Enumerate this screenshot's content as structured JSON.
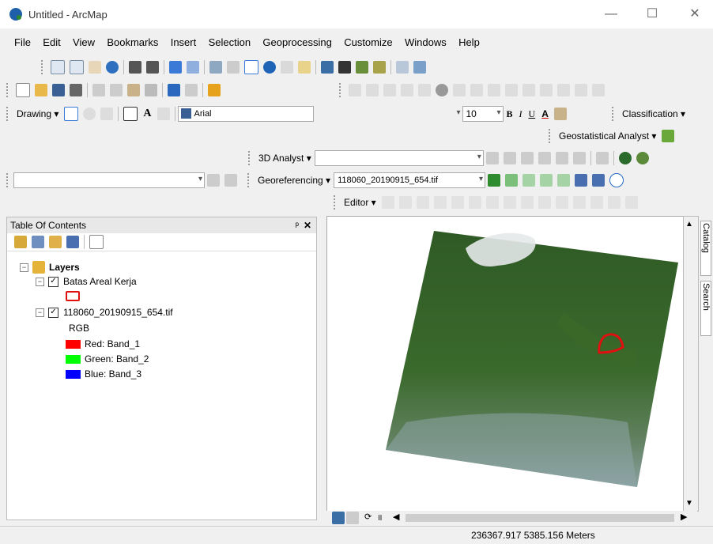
{
  "window": {
    "title": "Untitled - ArcMap",
    "minimize": "—",
    "maximize": "☐",
    "close": "✕"
  },
  "menu": [
    "File",
    "Edit",
    "View",
    "Bookmarks",
    "Insert",
    "Selection",
    "Geoprocessing",
    "Customize",
    "Windows",
    "Help"
  ],
  "toolbars": {
    "drawing": {
      "label": "Drawing ▾",
      "font": "Arial",
      "size": "10",
      "bold": "B",
      "italic": "I",
      "underline": "U",
      "textA": "A"
    },
    "classification": "Classification ▾",
    "geostatistical": "Geostatistical Analyst ▾",
    "analyst3d": "3D Analyst ▾",
    "georeferencing": {
      "label": "Georeferencing ▾",
      "layer": "118060_20190915_654.tif"
    },
    "editor": "Editor ▾"
  },
  "toc": {
    "title": "Table Of Contents",
    "pin": "ᵖ",
    "close": "✕",
    "layers_label": "Layers",
    "items": [
      {
        "name": "Batas Areal Kerja",
        "checked": "✓"
      },
      {
        "name": "118060_20190915_654.tif",
        "checked": "✓"
      }
    ],
    "rgb_label": "RGB",
    "bands": [
      {
        "label": "Red:  Band_1",
        "color": "#ff0000"
      },
      {
        "label": "Green: Band_2",
        "color": "#00ff00"
      },
      {
        "label": "Blue:  Band_3",
        "color": "#0000ff"
      }
    ]
  },
  "side_tabs": [
    "Catalog",
    "Search"
  ],
  "status": {
    "coords": "236367.917  5385.156 Meters"
  },
  "colors": {
    "polygon": "#e01010",
    "forest": "#2f5a2a"
  }
}
